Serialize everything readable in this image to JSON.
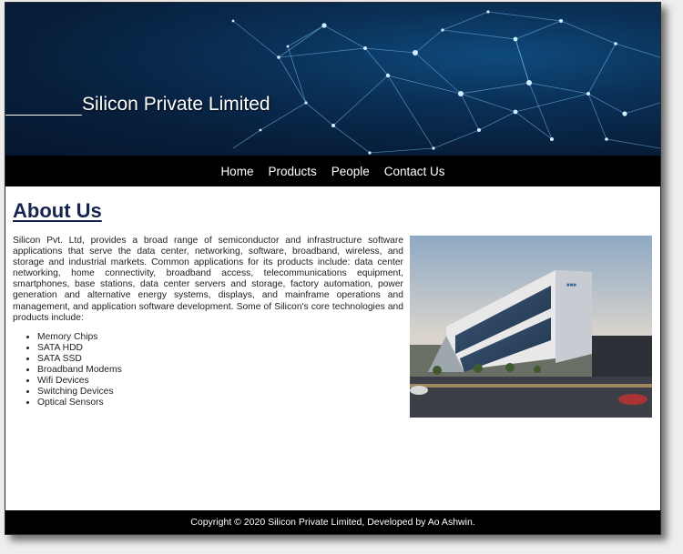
{
  "header": {
    "title": "Silicon Private Limited"
  },
  "nav": {
    "items": [
      {
        "label": "Home"
      },
      {
        "label": "Products"
      },
      {
        "label": "People"
      },
      {
        "label": "Contact Us"
      }
    ]
  },
  "about": {
    "heading": "About Us",
    "paragraph": "Silicon Pvt. Ltd, provides a broad range of semiconductor and infrastructure software applications that serve the data center, networking, software, broadband, wireless, and storage and industrial markets. Common applications for its products include: data center networking, home connectivity, broadband access, telecommunications equipment, smartphones, base stations, data center servers and storage, factory automation, power generation and alternative energy systems, displays, and mainframe operations and management, and application software development. Some of Silicon's core technologies and products include:",
    "products": [
      "Memory Chips",
      "SATA HDD",
      "SATA SSD",
      "Broadband Modems",
      "Wifi Devices",
      "Switching Devices",
      "Optical Sensors"
    ],
    "image_icon": "office-building-photo"
  },
  "footer": {
    "copyright": "Copyright © 2020 Silicon Private Limited, Developed by Ao Ashwin."
  },
  "colors": {
    "banner_dark": "#071e3a",
    "nav_bg": "#000000",
    "heading": "#16244f",
    "footer_bg": "#000000"
  }
}
